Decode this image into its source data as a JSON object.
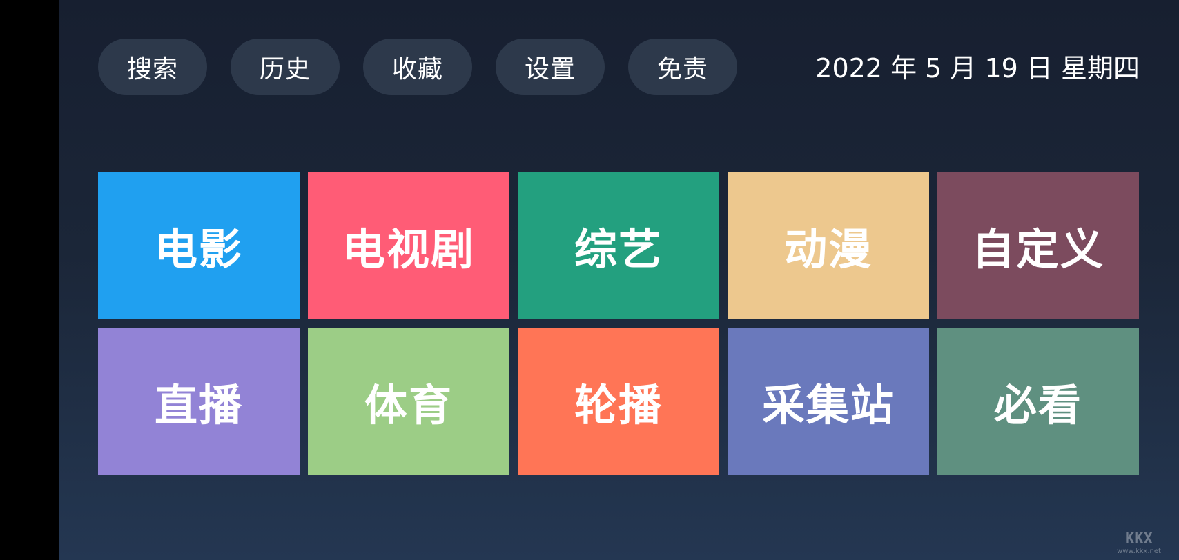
{
  "nav": [
    {
      "id": "search",
      "label": "搜索"
    },
    {
      "id": "history",
      "label": "历史"
    },
    {
      "id": "favorites",
      "label": "收藏"
    },
    {
      "id": "settings",
      "label": "设置"
    },
    {
      "id": "disclaimer",
      "label": "免责"
    }
  ],
  "date_text": "2022 年 5 月 19 日 星期四",
  "tiles": [
    {
      "id": "movie",
      "label": "电影",
      "color": "#20a0f0"
    },
    {
      "id": "tv-series",
      "label": "电视剧",
      "color": "#ff5c76"
    },
    {
      "id": "variety",
      "label": "综艺",
      "color": "#23a07f"
    },
    {
      "id": "anime",
      "label": "动漫",
      "color": "#edc88e"
    },
    {
      "id": "custom",
      "label": "自定义",
      "color": "#7c4b5e"
    },
    {
      "id": "live",
      "label": "直播",
      "color": "#9283d6"
    },
    {
      "id": "sports",
      "label": "体育",
      "color": "#9ccd86"
    },
    {
      "id": "carousel",
      "label": "轮播",
      "color": "#ff7556"
    },
    {
      "id": "collection-site",
      "label": "采集站",
      "color": "#6a79bc"
    },
    {
      "id": "must-watch",
      "label": "必看",
      "color": "#5f9080"
    }
  ],
  "watermark": {
    "logo": "KKX",
    "url": "www.kkx.net"
  }
}
